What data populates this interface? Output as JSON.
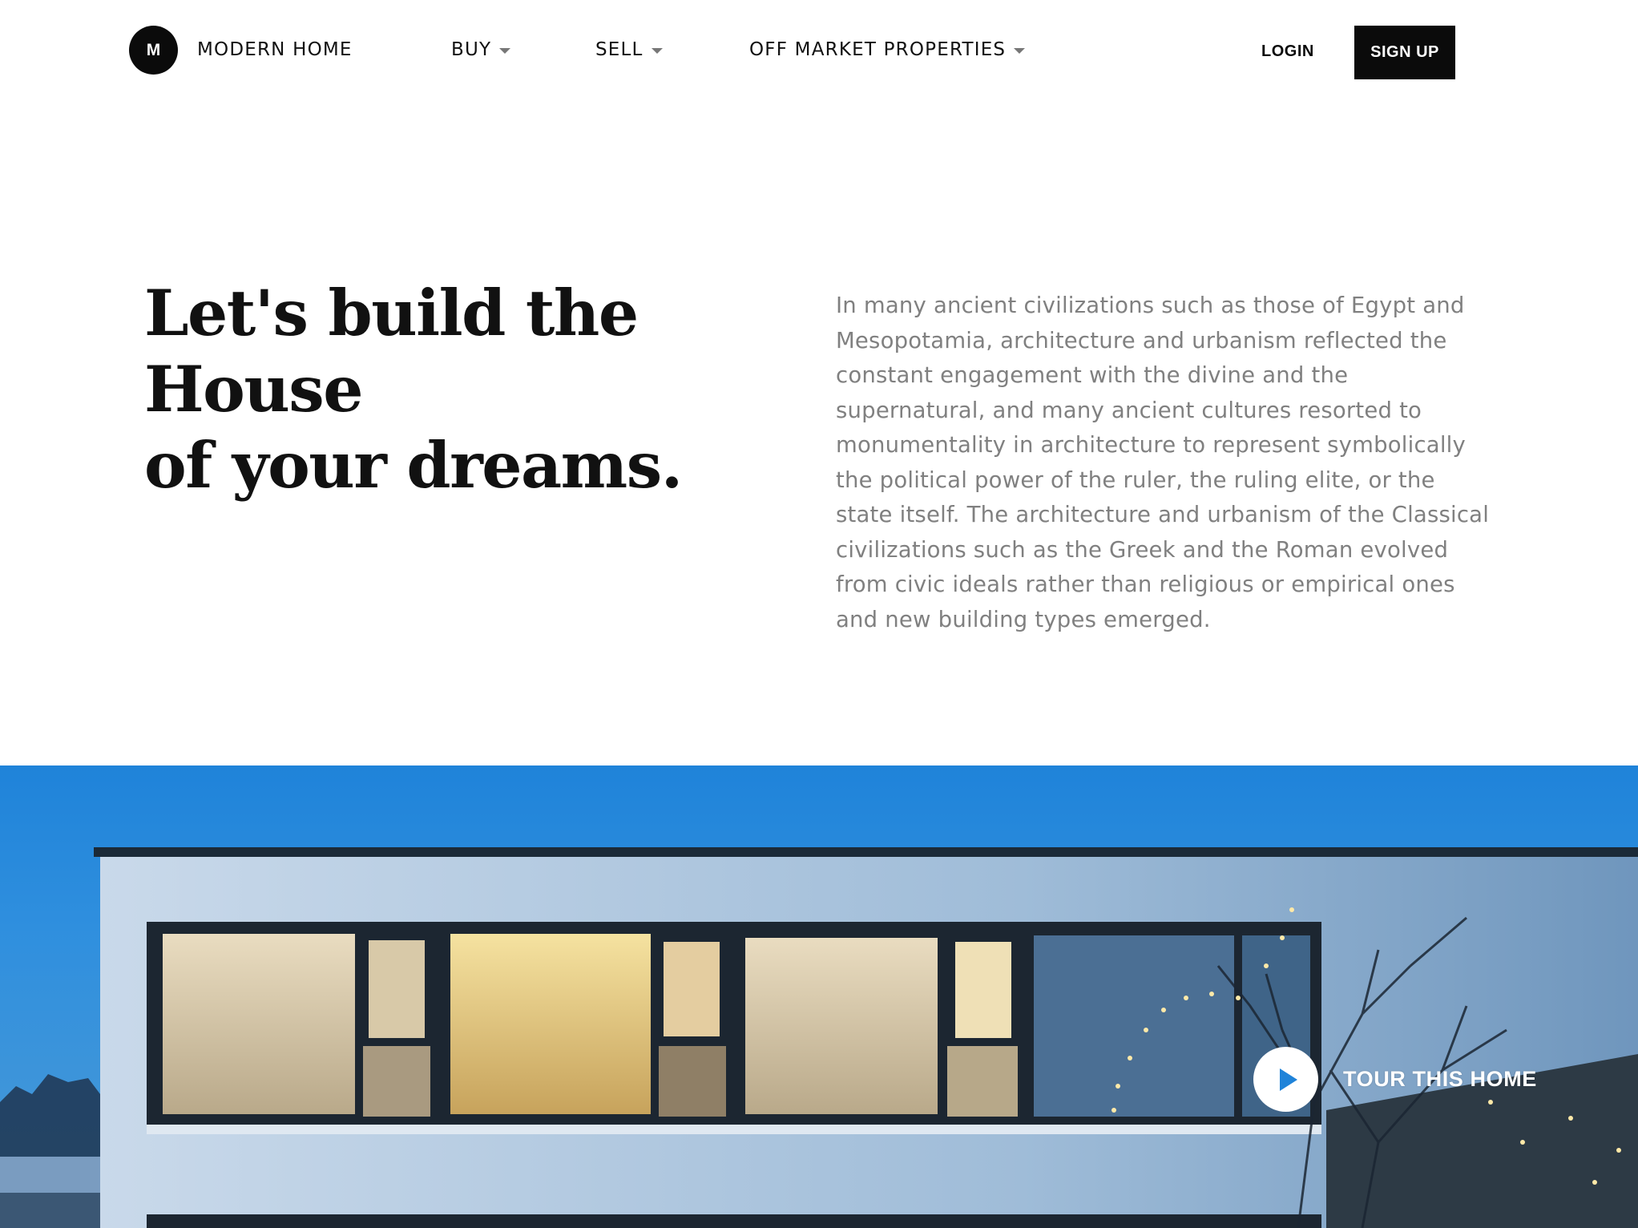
{
  "brand": {
    "logo_letter": "M",
    "name": "MODERN HOME"
  },
  "nav": {
    "items": [
      {
        "label": "BUY"
      },
      {
        "label": "SELL"
      },
      {
        "label": "OFF MARKET PROPERTIES"
      }
    ],
    "login_label": "LOGIN",
    "signup_label": "SIGN UP"
  },
  "hero": {
    "headline_line1": "Let's build the House",
    "headline_line2": "of your dreams.",
    "intro": "In many ancient civilizations such as those of Egypt and Mesopotamia, architecture and urbanism reflected the constant engagement with the divine and the supernatural, and many ancient cultures resorted to monumentality in architecture to represent symbolically the political power of the ruler, the ruling elite, or the state itself. The architecture and urbanism of the Classical civilizations such as the Greek and the Roman evolved from civic ideals rather than religious or empirical ones and new building types emerged."
  },
  "media": {
    "tour_label": "TOUR THIS HOME",
    "play_icon": "play-icon"
  },
  "colors": {
    "accent": "#1f83d9",
    "dark": "#0b0b0b",
    "muted_text": "#808080"
  }
}
